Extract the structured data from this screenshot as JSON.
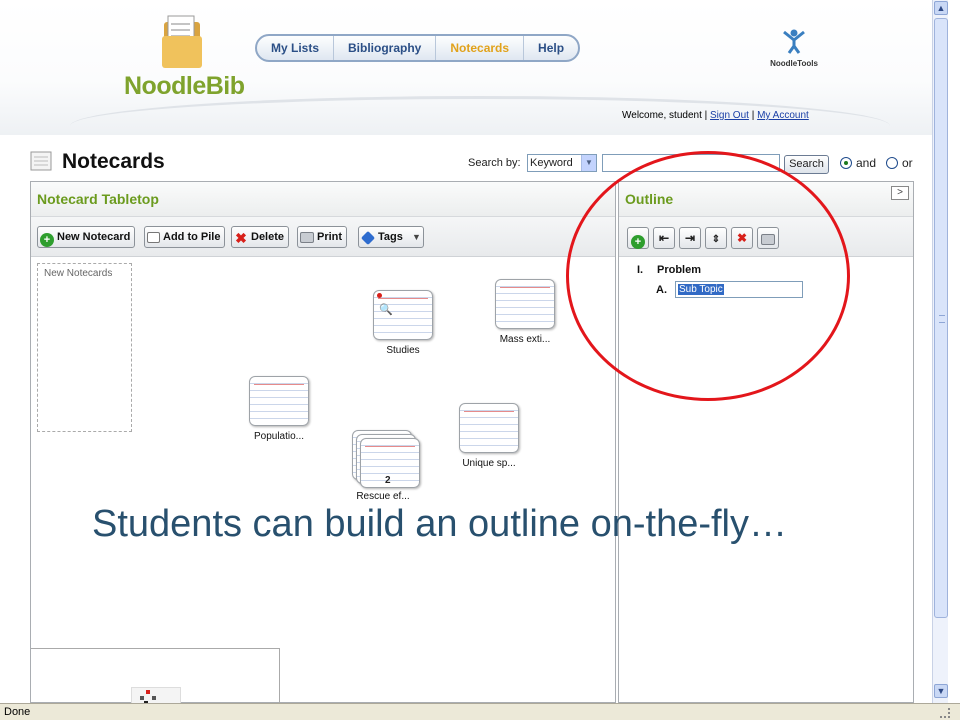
{
  "header": {
    "logo_text": "NoodleBib",
    "nav": [
      "My Lists",
      "Bibliography",
      "Notecards",
      "Help"
    ],
    "active_nav": "Notecards",
    "brand_right": "NoodleTools",
    "welcome_text": "Welcome, student",
    "sign_out": "Sign Out",
    "my_account": "My Account"
  },
  "titlebar": {
    "title": "Notecards",
    "search_label": "Search by:",
    "search_field": "Keyword",
    "search_value": "",
    "search_button": "Search",
    "radio_and": "and",
    "radio_or": "or",
    "selected_radio": "and"
  },
  "tabletop": {
    "title": "Notecard Tabletop",
    "buttons": [
      "New Notecard",
      "Add to Pile",
      "Delete",
      "Print",
      "Tags"
    ],
    "new_box_label": "New Notecards",
    "cards": [
      "Studies",
      "Mass exti...",
      "Populatio...",
      "Unique sp...",
      "Rescue ef..."
    ],
    "pile_count": "2"
  },
  "outline": {
    "title": "Outline",
    "expand_glyph": ">",
    "items": [
      {
        "marker": "I.",
        "text": "Problem"
      },
      {
        "marker": "A.",
        "text": "Sub Topic"
      }
    ]
  },
  "caption": "Students can build an outline on-the-fly…",
  "status": "Done",
  "colors": {
    "accent_green": "#6b9b1e",
    "nav_blue": "#2b4f86",
    "nav_active": "#e1a21b",
    "highlight_circle": "#e3161b",
    "caption": "#28506e"
  }
}
